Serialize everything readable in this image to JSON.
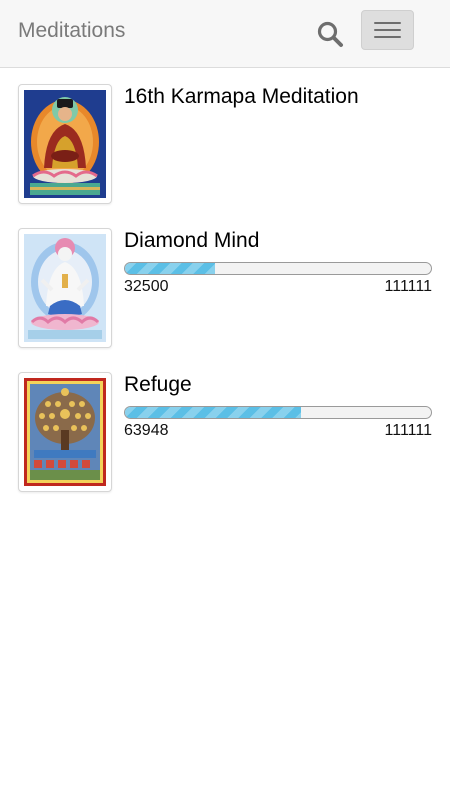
{
  "header": {
    "title": "Meditations",
    "search_icon": "search-icon",
    "menu_icon": "hamburger-menu-icon"
  },
  "meditations": [
    {
      "title": "16th Karmapa Meditation",
      "thumbnail": "karmapa-thangka-image",
      "has_progress": false
    },
    {
      "title": "Diamond Mind",
      "thumbnail": "diamond-mind-thangka-image",
      "has_progress": true,
      "current": "32500",
      "target": "111111",
      "progress_fraction": 0.2925
    },
    {
      "title": "Refuge",
      "thumbnail": "refuge-tree-thangka-image",
      "has_progress": true,
      "current": "63948",
      "target": "111111",
      "progress_fraction": 0.5755
    }
  ],
  "colors": {
    "progress_fill": "#5bbfe6",
    "header_bg": "#f7f7f7",
    "title_gray": "#7a7a7a"
  }
}
